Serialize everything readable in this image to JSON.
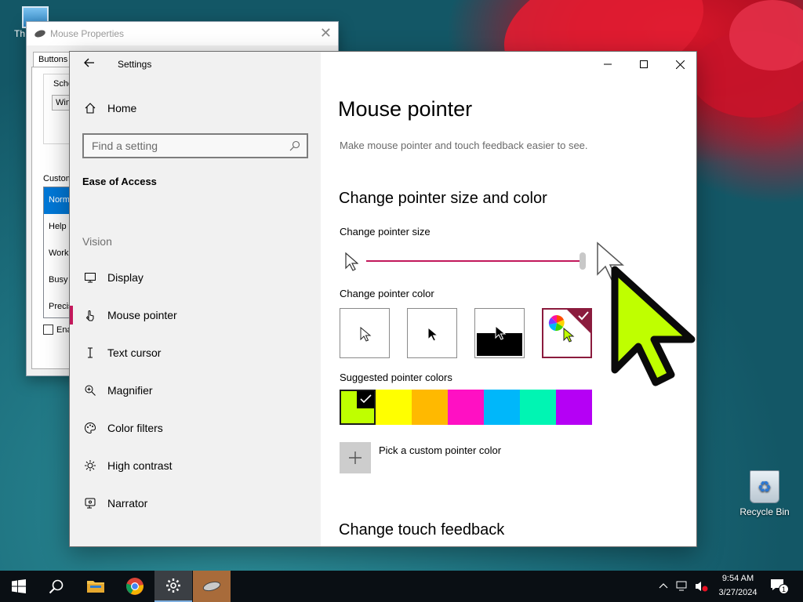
{
  "desktop": {
    "this_pc_label": "Th",
    "recycle_bin_label": "Recycle Bin"
  },
  "mouse_properties": {
    "title": "Mouse Properties",
    "tab_buttons": "Buttons",
    "scheme_label": "Sche",
    "scheme_value": "Win",
    "customize_label": "Custom",
    "list_items": [
      "Norma",
      "Help",
      "Work",
      "Busy",
      "Precis"
    ],
    "enable_checkbox_label": "Ena"
  },
  "settings": {
    "app_title": "Settings",
    "nav": {
      "home": "Home",
      "search_placeholder": "Find a setting",
      "category": "Ease of Access",
      "section": "Vision",
      "items": [
        "Display",
        "Mouse pointer",
        "Text cursor",
        "Magnifier",
        "Color filters",
        "High contrast",
        "Narrator"
      ]
    },
    "main": {
      "title": "Mouse pointer",
      "description": "Make mouse pointer and touch feedback easier to see.",
      "section_size_color": "Change pointer size and color",
      "pointer_size_label": "Change pointer size",
      "pointer_size_level": 1.0,
      "pointer_color_label": "Change pointer color",
      "suggested_label": "Suggested pointer colors",
      "suggested_colors": [
        "#bfff00",
        "#ffff00",
        "#ffb900",
        "#ff10c3",
        "#00b7fa",
        "#00f5b3",
        "#b500f5"
      ],
      "custom_color_label": "Pick a custom pointer color",
      "section_touch": "Change touch feedback",
      "selected_color": "#bfff00"
    }
  },
  "taskbar": {
    "time": "9:54 AM",
    "date": "3/27/2024",
    "notification_count": "1"
  }
}
